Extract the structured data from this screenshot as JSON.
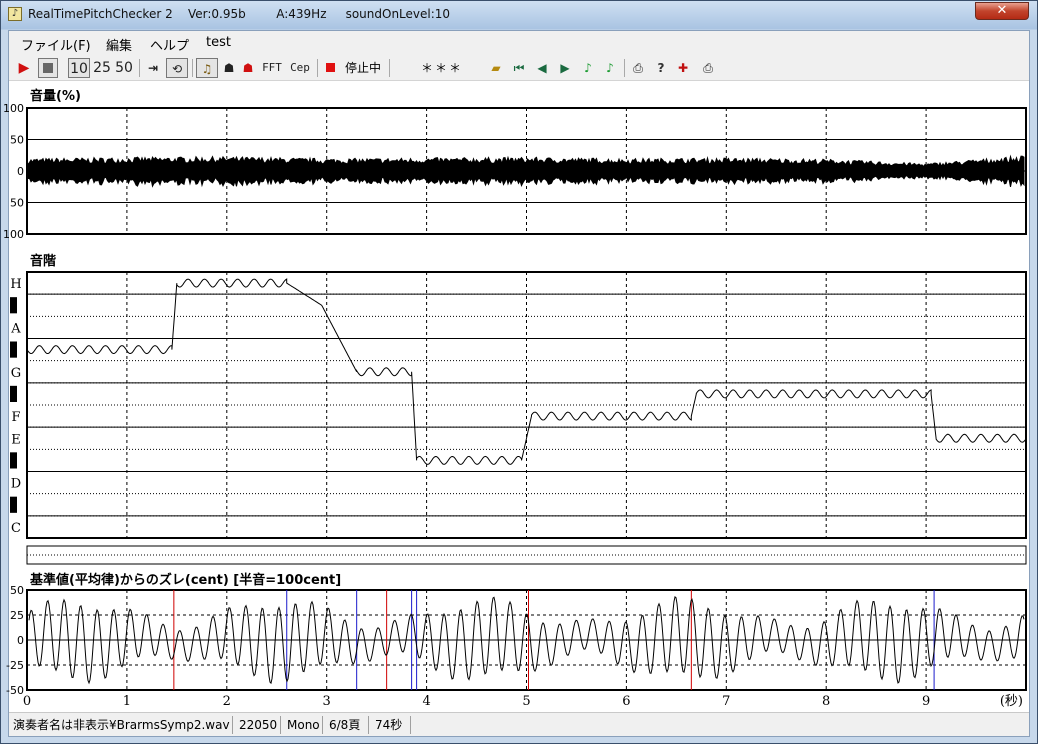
{
  "window": {
    "title": "RealTimePitchChecker 2    Ver:0.95b        A:439Hz     soundOnLevel:10",
    "close_label": "✕"
  },
  "menu": [
    "ファイル(F)",
    "編集",
    "ヘルプ",
    "test"
  ],
  "toolbar": {
    "speed_options": [
      "10",
      "25",
      "50"
    ],
    "fft_label": "FFT",
    "cep_label": "Cep",
    "status_text": "停止中",
    "display_text": "＊＊＊"
  },
  "volume_panel": {
    "title": "音量(%)",
    "y_labels": [
      "100",
      "50",
      "0",
      "50",
      "100"
    ]
  },
  "scale_panel": {
    "title": "音階",
    "notes": [
      "H",
      "A",
      "G",
      "F",
      "E",
      "D",
      "C"
    ]
  },
  "cent_panel": {
    "title": "基準値(平均律)からのズレ(cent) [半音=100cent]",
    "y_labels": [
      "50",
      "25",
      "0",
      "-25",
      "-50"
    ]
  },
  "time_axis": {
    "ticks": [
      "0",
      "1",
      "2",
      "3",
      "4",
      "5",
      "6",
      "7",
      "8",
      "9"
    ],
    "unit": "(秒)"
  },
  "statusbar": {
    "file": "演奏者名は非表示¥BrarmsSymp2.wav",
    "rate": "22050",
    "channels": "Mono",
    "page": "6/8頁",
    "duration": "74秒"
  },
  "chart_data": [
    {
      "type": "area",
      "title": "音量(%)",
      "x_range": [
        0,
        10
      ],
      "y_range": [
        -100,
        100
      ],
      "description_values": {
        "x": [
          0,
          1,
          2,
          3,
          4,
          5,
          6,
          7,
          8,
          9,
          10
        ],
        "amplitude": [
          20,
          22,
          23,
          20,
          21,
          22,
          20,
          21,
          19,
          12,
          25
        ]
      }
    },
    {
      "type": "line",
      "title": "音階",
      "x": [
        0.0,
        1.45,
        1.5,
        2.6,
        2.95,
        3.3,
        3.85,
        3.9,
        4.0,
        4.95,
        5.05,
        6.65,
        6.7,
        9.05,
        9.1,
        10.0
      ],
      "y_note": [
        "A♭",
        "A♭",
        "H",
        "H",
        "B",
        "G",
        "G",
        "E♭",
        "E♭",
        "E♭",
        "F",
        "F",
        "F♯",
        "F♯",
        "E",
        "E"
      ]
    },
    {
      "type": "line",
      "title": "基準値(平均律)からのズレ(cent) [半音=100cent]",
      "x_range": [
        0,
        10
      ],
      "y_range": [
        -50,
        50
      ]
    }
  ]
}
